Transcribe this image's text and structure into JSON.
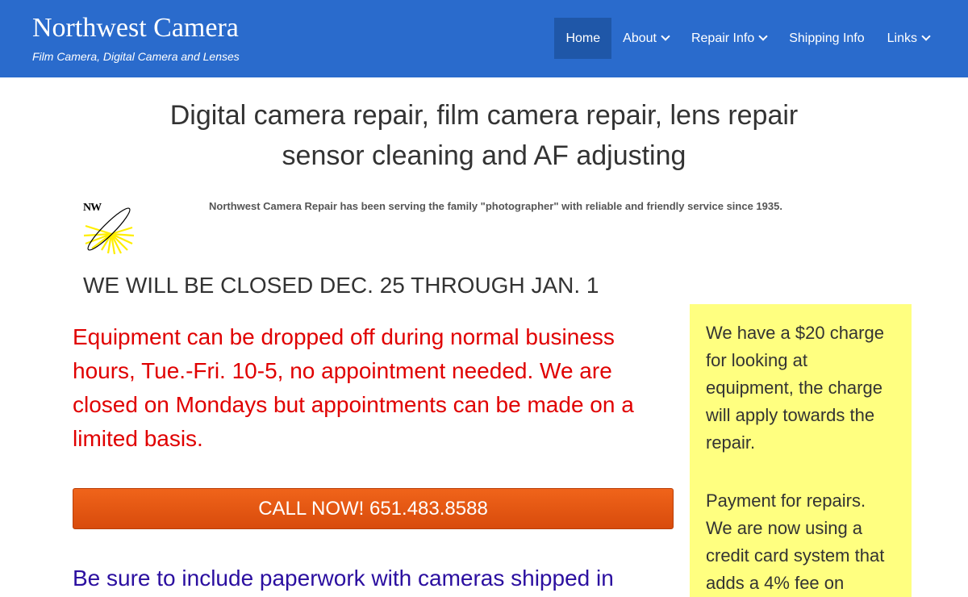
{
  "header": {
    "brand_title": "Northwest Camera",
    "brand_tagline": "Film Camera, Digital Camera and Lenses",
    "background_color": "#2a6bcc",
    "nav": [
      {
        "label": "Home",
        "active": true,
        "has_dropdown": false
      },
      {
        "label": "About",
        "active": false,
        "has_dropdown": true
      },
      {
        "label": "Repair Info",
        "active": false,
        "has_dropdown": true
      },
      {
        "label": "Shipping Info",
        "active": false,
        "has_dropdown": false
      },
      {
        "label": "Links",
        "active": false,
        "has_dropdown": true
      }
    ]
  },
  "main": {
    "headline_line1": "Digital camera repair, film camera repair, lens repair",
    "headline_line2": "sensor cleaning and AF adjusting",
    "logo_text": "NW",
    "intro": "Northwest Camera Repair has been serving the family \"photographer\" with reliable and friendly service since 1935.",
    "closed_notice": "WE WILL BE CLOSED DEC. 25 THROUGH JAN. 1",
    "dropoff_notice": "Equipment can be dropped off during normal business hours, Tue.-Fri. 10-5, no appointment needed. We are closed on Mondays but appointments can be made on a limited basis.",
    "call_button": "CALL NOW! 651.483.8588",
    "paperwork_notice": "Be sure to include paperwork with cameras shipped in"
  },
  "sidebar": {
    "background_color": "#ffff80",
    "charge_notice": "We have a $20 charge for looking at equipment, the charge will apply towards the repair.",
    "payment_notice": "Payment for repairs. We are now using a credit card system that adds a 4% fee on"
  }
}
